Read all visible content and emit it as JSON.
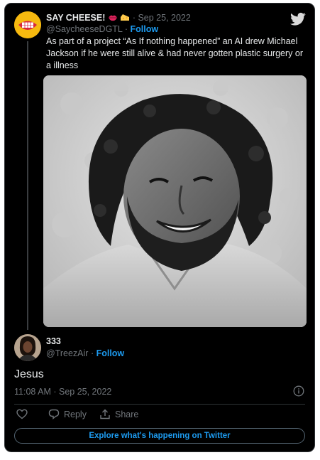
{
  "tweet": {
    "author_name": "SAY CHEESE!",
    "author_emojis": [
      "lips",
      "cheese"
    ],
    "date": "Sep 25, 2022",
    "handle": "@SaycheeseDGTL",
    "follow_label": "Follow",
    "text": "As part of a project “As If nothing happened” an AI drew Michael Jackson if he were still alive & had never gotten plastic surgery or a illness",
    "image": "black-and-white-portrait-photo"
  },
  "reply": {
    "author_name": "333",
    "handle": "@TreezAir",
    "follow_label": "Follow",
    "text": "Jesus",
    "timestamp": "11:08 AM · Sep 25, 2022"
  },
  "actions": {
    "like_icon": "heart-icon",
    "reply_label": "Reply",
    "share_label": "Share"
  },
  "explore_label": "Explore what's happening on Twitter",
  "colors": {
    "background": "#000000",
    "accent": "#1d9bf0",
    "text": "#e7e9ea",
    "muted": "#71767b",
    "border": "#2f3336"
  }
}
